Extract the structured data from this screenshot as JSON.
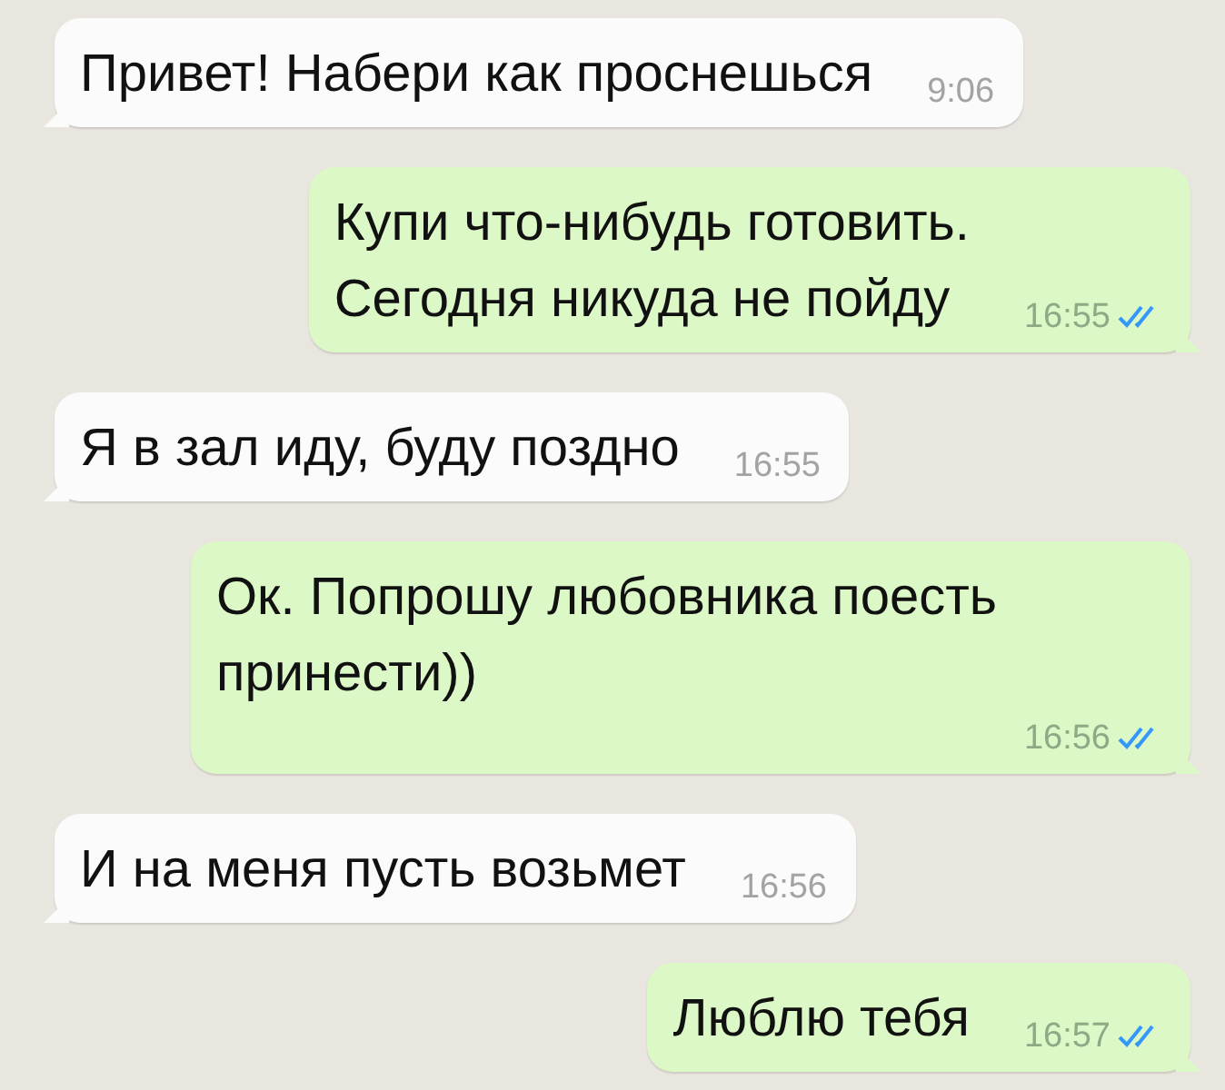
{
  "messages": [
    {
      "kind": "incoming",
      "text": "Привет! Набери как проснешься",
      "time": "9:06"
    },
    {
      "kind": "outgoing",
      "text": "Купи что-нибудь готовить.\nСегодня никуда не пойду",
      "time": "16:55",
      "read": true
    },
    {
      "kind": "incoming",
      "text": "Я в зал иду, буду поздно",
      "time": "16:55"
    },
    {
      "kind": "outgoing",
      "text": "Ок. Попрошу любовника поесть\nпринести))",
      "time": "16:56",
      "read": true
    },
    {
      "kind": "incoming",
      "text": "И на меня пусть возьмет",
      "time": "16:56"
    },
    {
      "kind": "outgoing",
      "text": "Люблю тебя",
      "time": "16:57",
      "read": true
    }
  ]
}
